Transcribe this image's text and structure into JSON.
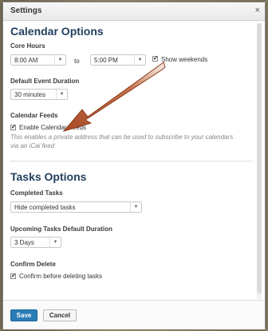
{
  "dialog": {
    "title": "Settings",
    "close": "×"
  },
  "calendar": {
    "heading": "Calendar Options",
    "core_hours_label": "Core Hours",
    "start_time": "8:00 AM",
    "to_label": "to",
    "end_time": "5:00 PM",
    "show_weekends_label": "Show weekends",
    "default_duration_label": "Default Event Duration",
    "default_duration_value": "30 minutes",
    "feeds_label": "Calendar Feeds",
    "enable_feeds_label": "Enable Calendar Feeds",
    "feeds_help": "This enables a private address that can be used to subscribe to your calendars via an iCal feed"
  },
  "tasks": {
    "heading": "Tasks Options",
    "completed_label": "Completed Tasks",
    "completed_value": "Hide completed tasks",
    "upcoming_label": "Upcoming Tasks Default Duration",
    "upcoming_value": "3 Days",
    "confirm_label": "Confirm Delete",
    "confirm_checkbox_label": "Confirm before deleting tasks"
  },
  "footer": {
    "save": "Save",
    "cancel": "Cancel"
  },
  "colors": {
    "heading": "#23405f",
    "primary_button": "#2a7cb5",
    "annotation_arrow": "#b5562e"
  }
}
